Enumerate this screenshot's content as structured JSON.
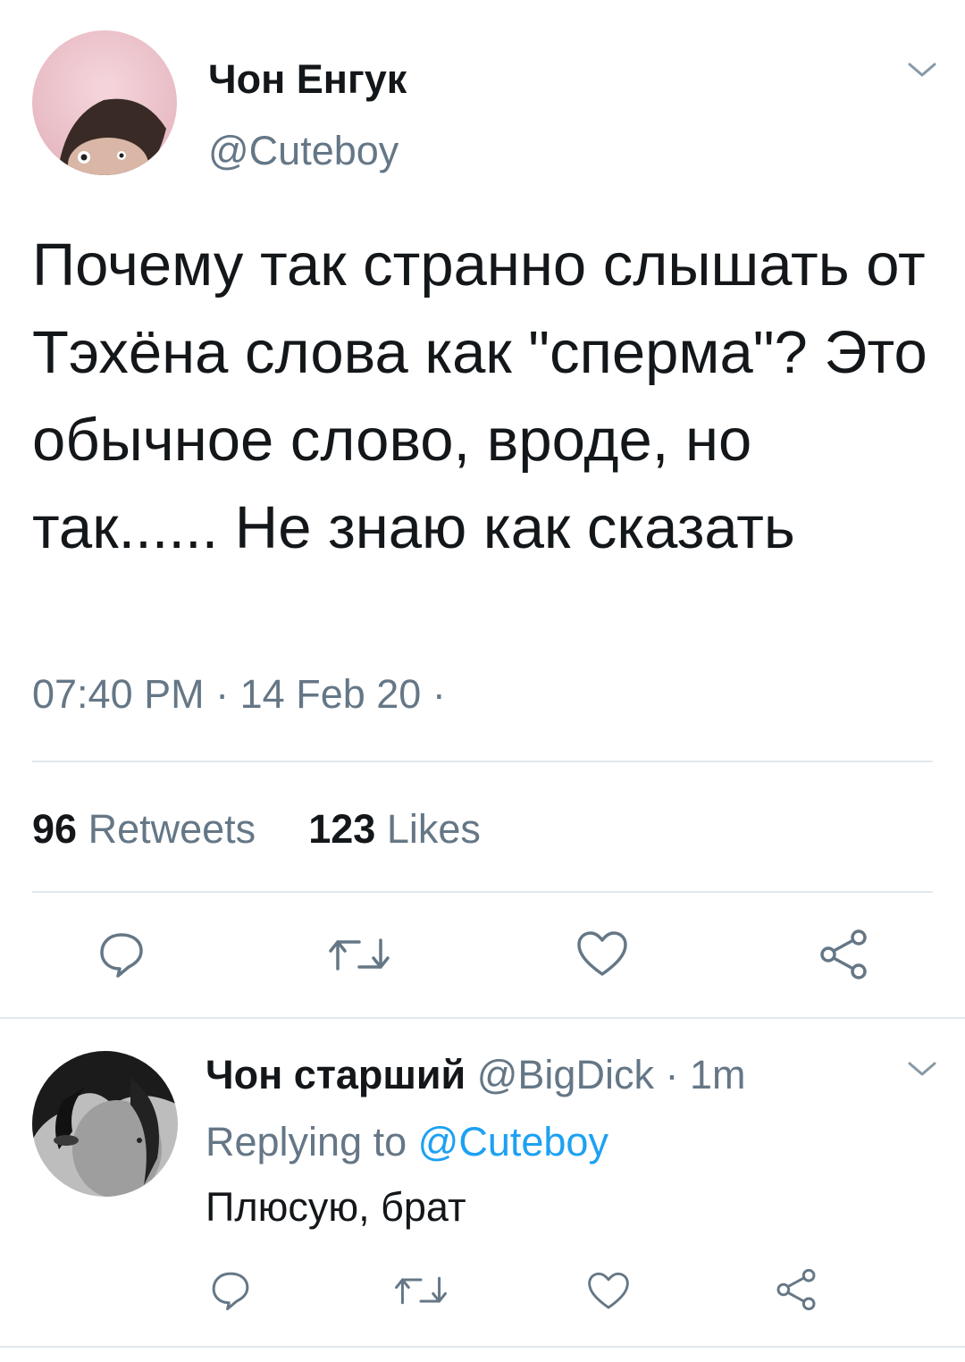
{
  "tweet": {
    "author": {
      "display_name": "Чон Енгук",
      "handle": "@Cuteboy"
    },
    "text": "Почему так странно слышать от Тэхёна слова как \"сперма\"? Это обычное слово, вроде, но так...... Не знаю как сказать",
    "time": "07:40 PM",
    "separator": "·",
    "date": "14 Feb 20",
    "trailing_separator": "·",
    "stats": {
      "retweets_count": "96",
      "retweets_label": "Retweets",
      "likes_count": "123",
      "likes_label": "Likes"
    },
    "actions": [
      "reply-icon",
      "retweet-icon",
      "like-icon",
      "share-icon"
    ]
  },
  "reply": {
    "author": {
      "display_name": "Чон старший",
      "handle": "@BigDick",
      "separator": "·",
      "age": "1m"
    },
    "replying_to_label": "Replying to",
    "replying_to_handle": "@Cuteboy",
    "text": "Плюсую, брат",
    "actions": [
      "reply-icon",
      "retweet-icon",
      "like-icon",
      "share-icon"
    ]
  },
  "colors": {
    "text_primary": "#14171a",
    "text_secondary": "#657786",
    "link": "#1da1f2",
    "divider": "#e1e8ed"
  }
}
